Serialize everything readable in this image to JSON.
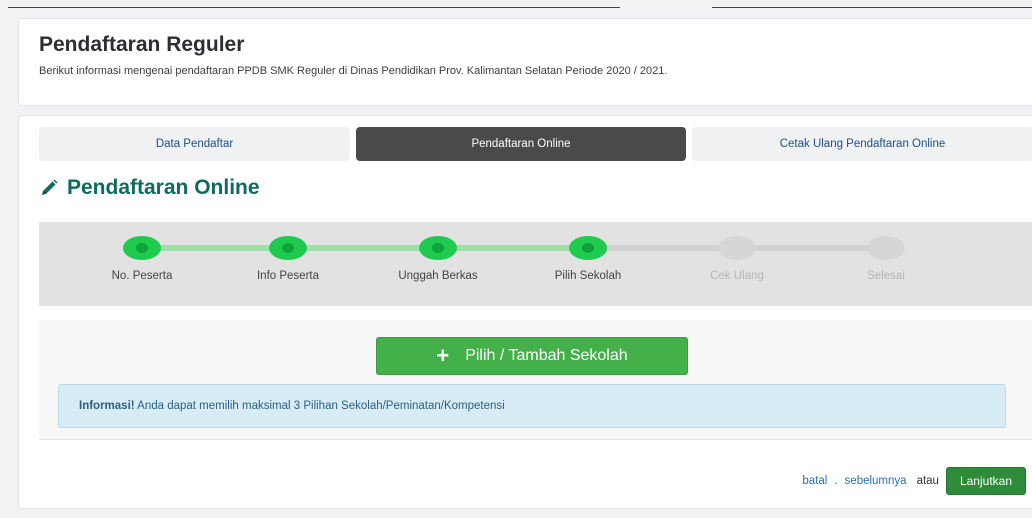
{
  "header": {
    "title": "Pendaftaran Reguler",
    "description": "Berikut informasi mengenai pendaftaran PPDB SMK Reguler di Dinas Pendidikan Prov. Kalimantan Selatan Periode 2020 / 2021."
  },
  "tabs": [
    {
      "label": "Data Pendaftar",
      "active": false
    },
    {
      "label": "Pendaftaran Online",
      "active": true
    },
    {
      "label": "Cetak Ulang Pendaftaran Online",
      "active": false
    }
  ],
  "section": {
    "title": "Pendaftaran Online",
    "icon": "pencil-icon"
  },
  "steps": [
    {
      "label": "No. Peserta",
      "done": true
    },
    {
      "label": "Info Peserta",
      "done": true
    },
    {
      "label": "Unggah Berkas",
      "done": true
    },
    {
      "label": "Pilih Sekolah",
      "done": true
    },
    {
      "label": "Cek Ulang",
      "done": false
    },
    {
      "label": "Selesai",
      "done": false
    }
  ],
  "actions": {
    "add_school_label": "Pilih / Tambah Sekolah",
    "add_icon": "plus-icon"
  },
  "info": {
    "strong": "Informasi!",
    "text": " Anda dapat memilih maksimal 3 Pilihan Sekolah/Peminatan/Kompetensi"
  },
  "footer": {
    "cancel_label": "batal",
    "separator": ".",
    "previous_label": "sebelumnya",
    "or_label": "atau",
    "next_label": "Lanjutkan"
  },
  "colors": {
    "accent_green": "#43b04a",
    "step_done": "#1ecb4f",
    "title_teal": "#0f6b5f",
    "active_tab": "#4a4a4a"
  }
}
